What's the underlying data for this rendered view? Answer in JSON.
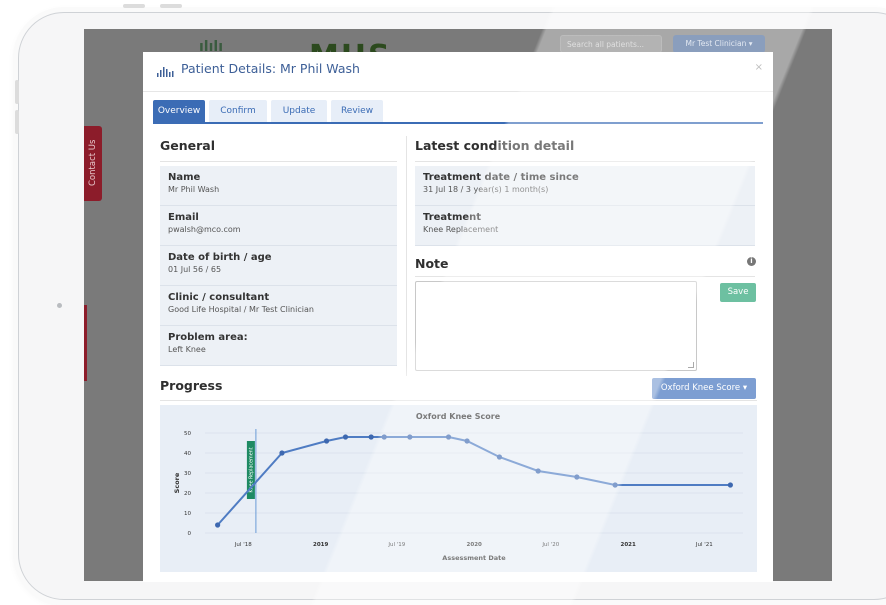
{
  "background": {
    "logo_left": "ılılı",
    "logo_text": "MHS",
    "search_placeholder": "Search all patients...",
    "user_menu": "Mr Test Clinician",
    "contact_tab": "Contact Us"
  },
  "modal": {
    "title": "Patient Details: Mr Phil Wash",
    "close": "×",
    "tabs": [
      {
        "label": "Overview",
        "active": true
      },
      {
        "label": "Confirm",
        "active": false
      },
      {
        "label": "Update",
        "active": false
      },
      {
        "label": "Review",
        "active": false
      }
    ]
  },
  "general": {
    "heading": "General",
    "items": [
      {
        "label": "Name",
        "value": "Mr Phil Wash"
      },
      {
        "label": "Email",
        "value": "pwalsh@mco.com"
      },
      {
        "label": "Date of birth / age",
        "value": "01 Jul 56 / 65"
      },
      {
        "label": "Clinic / consultant",
        "value": "Good Life Hospital / Mr Test Clinician"
      },
      {
        "label": "Problem area:",
        "value": "Left Knee"
      }
    ]
  },
  "condition": {
    "heading": "Latest condition detail",
    "items": [
      {
        "label": "Treatment date / time since",
        "value": "31 Jul 18 / 3 year(s) 1 month(s)"
      },
      {
        "label": "Treatment",
        "value": "Knee Replacement"
      }
    ]
  },
  "note": {
    "heading": "Note",
    "info_icon": "i",
    "value": "",
    "save_label": "Save"
  },
  "progress": {
    "heading": "Progress",
    "score_select": "Oxford Knee Score"
  },
  "colors": {
    "primary": "#3b6cb5",
    "line": "#4f7cc3",
    "marker": "#1e8a63",
    "save": "#6dc0a1"
  },
  "chart_data": {
    "type": "line",
    "title": "Oxford Knee Score",
    "xlabel": "Assessment Date",
    "ylabel": "Score",
    "ylim": [
      0,
      50
    ],
    "yticks": [
      0,
      10,
      20,
      30,
      40,
      50
    ],
    "xticks": [
      "Jul '18",
      "2019",
      "Jul '19",
      "2020",
      "Jul '20",
      "2021",
      "Jul '21"
    ],
    "grid": true,
    "series": [
      {
        "values": [
          {
            "x": "2018-05-01",
            "y": 4
          },
          {
            "x": "2018-10-01",
            "y": 40
          },
          {
            "x": "2019-01-15",
            "y": 46
          },
          {
            "x": "2019-03-01",
            "y": 48
          },
          {
            "x": "2019-05-01",
            "y": 48
          },
          {
            "x": "2019-06-01",
            "y": 48
          },
          {
            "x": "2019-08-01",
            "y": 48
          },
          {
            "x": "2019-11-01",
            "y": 48
          },
          {
            "x": "2019-12-15",
            "y": 46
          },
          {
            "x": "2020-03-01",
            "y": 38
          },
          {
            "x": "2020-06-01",
            "y": 31
          },
          {
            "x": "2020-09-01",
            "y": 28
          },
          {
            "x": "2020-12-01",
            "y": 24
          },
          {
            "x": "2021-09-01",
            "y": 24
          }
        ]
      }
    ],
    "annotation": {
      "label": "Knee Replacement",
      "x": "2018-07-31"
    }
  }
}
